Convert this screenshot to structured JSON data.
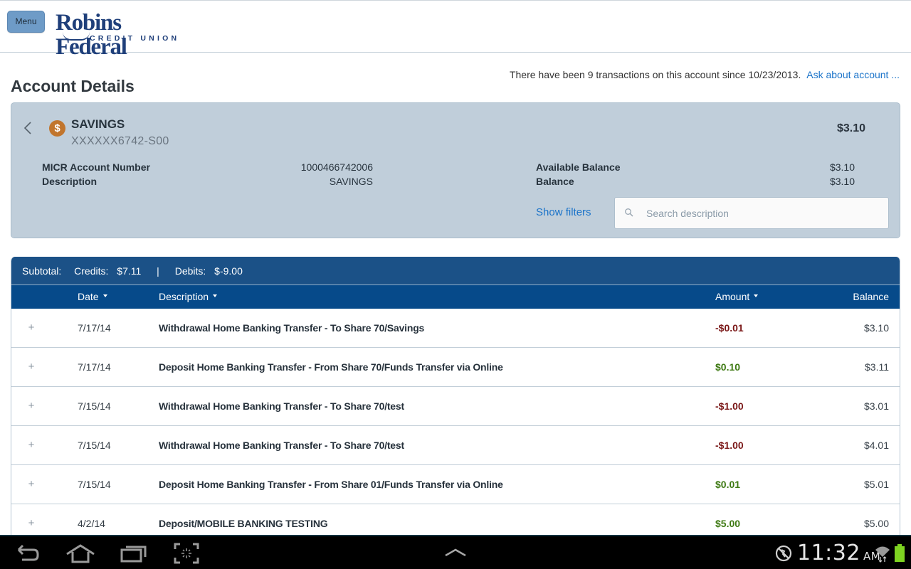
{
  "header": {
    "menu_label": "Menu",
    "logo_main": "Robins Federal",
    "logo_sub": "CREDIT UNION"
  },
  "page": {
    "title": "Account Details",
    "txn_info": "There have been 9 transactions on this account since 10/23/2013.",
    "ask_link": "Ask about account ..."
  },
  "account": {
    "icon": "dollar-icon",
    "name": "SAVINGS",
    "number": "XXXXXX6742-S00",
    "total": "$3.10",
    "details_left": [
      {
        "label": "MICR Account Number",
        "value": "1000466742006"
      },
      {
        "label": "Description",
        "value": "SAVINGS"
      }
    ],
    "details_right": [
      {
        "label": "Available Balance",
        "value": "$3.10"
      },
      {
        "label": "Balance",
        "value": "$3.10"
      }
    ],
    "show_filters": "Show filters",
    "search_placeholder": "Search description",
    "search_value": ""
  },
  "subtotal": {
    "label": "Subtotal:",
    "credits_label": "Credits:",
    "credits_value": "$7.11",
    "separator": "|",
    "debits_label": "Debits:",
    "debits_value": "$-9.00"
  },
  "table": {
    "columns": {
      "date": "Date",
      "description": "Description",
      "amount": "Amount",
      "balance": "Balance"
    },
    "colors": {
      "negative": "#7a1717",
      "positive": "#3f7a14"
    },
    "rows": [
      {
        "expand": "+",
        "date": "7/17/14",
        "description": "Withdrawal Home Banking Transfer - To Share 70/Savings",
        "amount": "-$0.01",
        "type": "neg",
        "balance": "$3.10"
      },
      {
        "expand": "+",
        "date": "7/17/14",
        "description": "Deposit Home Banking Transfer - From Share 70/Funds Transfer via Online",
        "amount": "$0.10",
        "type": "pos",
        "balance": "$3.11"
      },
      {
        "expand": "+",
        "date": "7/15/14",
        "description": "Withdrawal Home Banking Transfer - To Share 70/test",
        "amount": "-$1.00",
        "type": "neg",
        "balance": "$3.01"
      },
      {
        "expand": "+",
        "date": "7/15/14",
        "description": "Withdrawal Home Banking Transfer - To Share 70/test",
        "amount": "-$1.00",
        "type": "neg",
        "balance": "$4.01"
      },
      {
        "expand": "+",
        "date": "7/15/14",
        "description": "Deposit Home Banking Transfer - From Share 01/Funds Transfer via Online",
        "amount": "$0.01",
        "type": "pos",
        "balance": "$5.01"
      },
      {
        "expand": "+",
        "date": "4/2/14",
        "description": "Deposit/MOBILE BANKING TESTING",
        "amount": "$5.00",
        "type": "pos",
        "balance": "$5.00"
      }
    ]
  },
  "system_bar": {
    "nav_icons": [
      "back-icon",
      "home-icon",
      "recent-apps-icon",
      "screenshot-icon",
      "expand-up-icon"
    ],
    "status_icons": [
      "no-sync-icon",
      "wifi-icon",
      "battery-icon"
    ],
    "time": "11:32",
    "ampm": "AM",
    "battery_color": "#7ed321"
  }
}
